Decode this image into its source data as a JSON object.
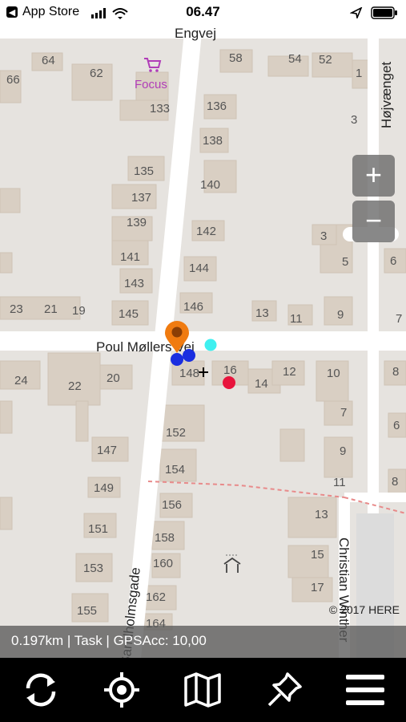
{
  "status_bar": {
    "back_app": "App Store",
    "time": "06.47"
  },
  "map": {
    "streets": {
      "top": "Engvej",
      "right": "Højvænget",
      "middle": "Poul Møllers Vej",
      "left": "Sandholmsgade",
      "bottom_right": "Christian Winther"
    },
    "poi": {
      "name": "Focus"
    },
    "house_numbers": {
      "n64": "64",
      "n66": "66",
      "n62": "62",
      "n133": "133",
      "n58": "58",
      "n54": "54",
      "n52": "52",
      "n1": "1",
      "n3": "3",
      "n136": "136",
      "n138": "138",
      "n135": "135",
      "n137": "137",
      "n140": "140",
      "n139": "139",
      "n142": "142",
      "n141": "141",
      "n143": "143",
      "n144": "144",
      "n146": "146",
      "n145": "145",
      "n23": "23",
      "n21": "21",
      "n19": "19",
      "n13a": "13",
      "n11a": "11",
      "n9a": "9",
      "n3b": "3",
      "n5": "5",
      "n6": "6",
      "n7": "7",
      "n24": "24",
      "n22": "22",
      "n20": "20",
      "n148": "148",
      "n16": "16",
      "n14": "14",
      "n12": "12",
      "n10": "10",
      "n8": "8",
      "n7b": "7",
      "n152": "152",
      "n147": "147",
      "n154": "154",
      "n9b": "9",
      "n149": "149",
      "n11b": "11",
      "n156": "156",
      "n13b": "13",
      "n151": "151",
      "n158": "158",
      "n15": "15",
      "n160": "160",
      "n153": "153",
      "n17": "17",
      "n162": "162",
      "n155": "155",
      "n164": "164",
      "n6b": "6",
      "n8b": "8"
    },
    "zoom_in": "+",
    "zoom_out": "−",
    "copyright": "© 2017 HERE"
  },
  "info_bar": {
    "text": "0.197km | Task | GPSAcc: 10,00"
  },
  "colors": {
    "road": "#ffffff",
    "building": "#d8cfc4",
    "pin": "#f07b10",
    "blue_dot": "#1a2ee0",
    "cyan_dot": "#3ff0f0",
    "red_dot": "#e8143c",
    "poi": "#b03cb8"
  },
  "toolbar": {
    "icons": [
      "refresh-icon",
      "locate-icon",
      "map-icon",
      "pin-icon",
      "menu-icon"
    ]
  }
}
